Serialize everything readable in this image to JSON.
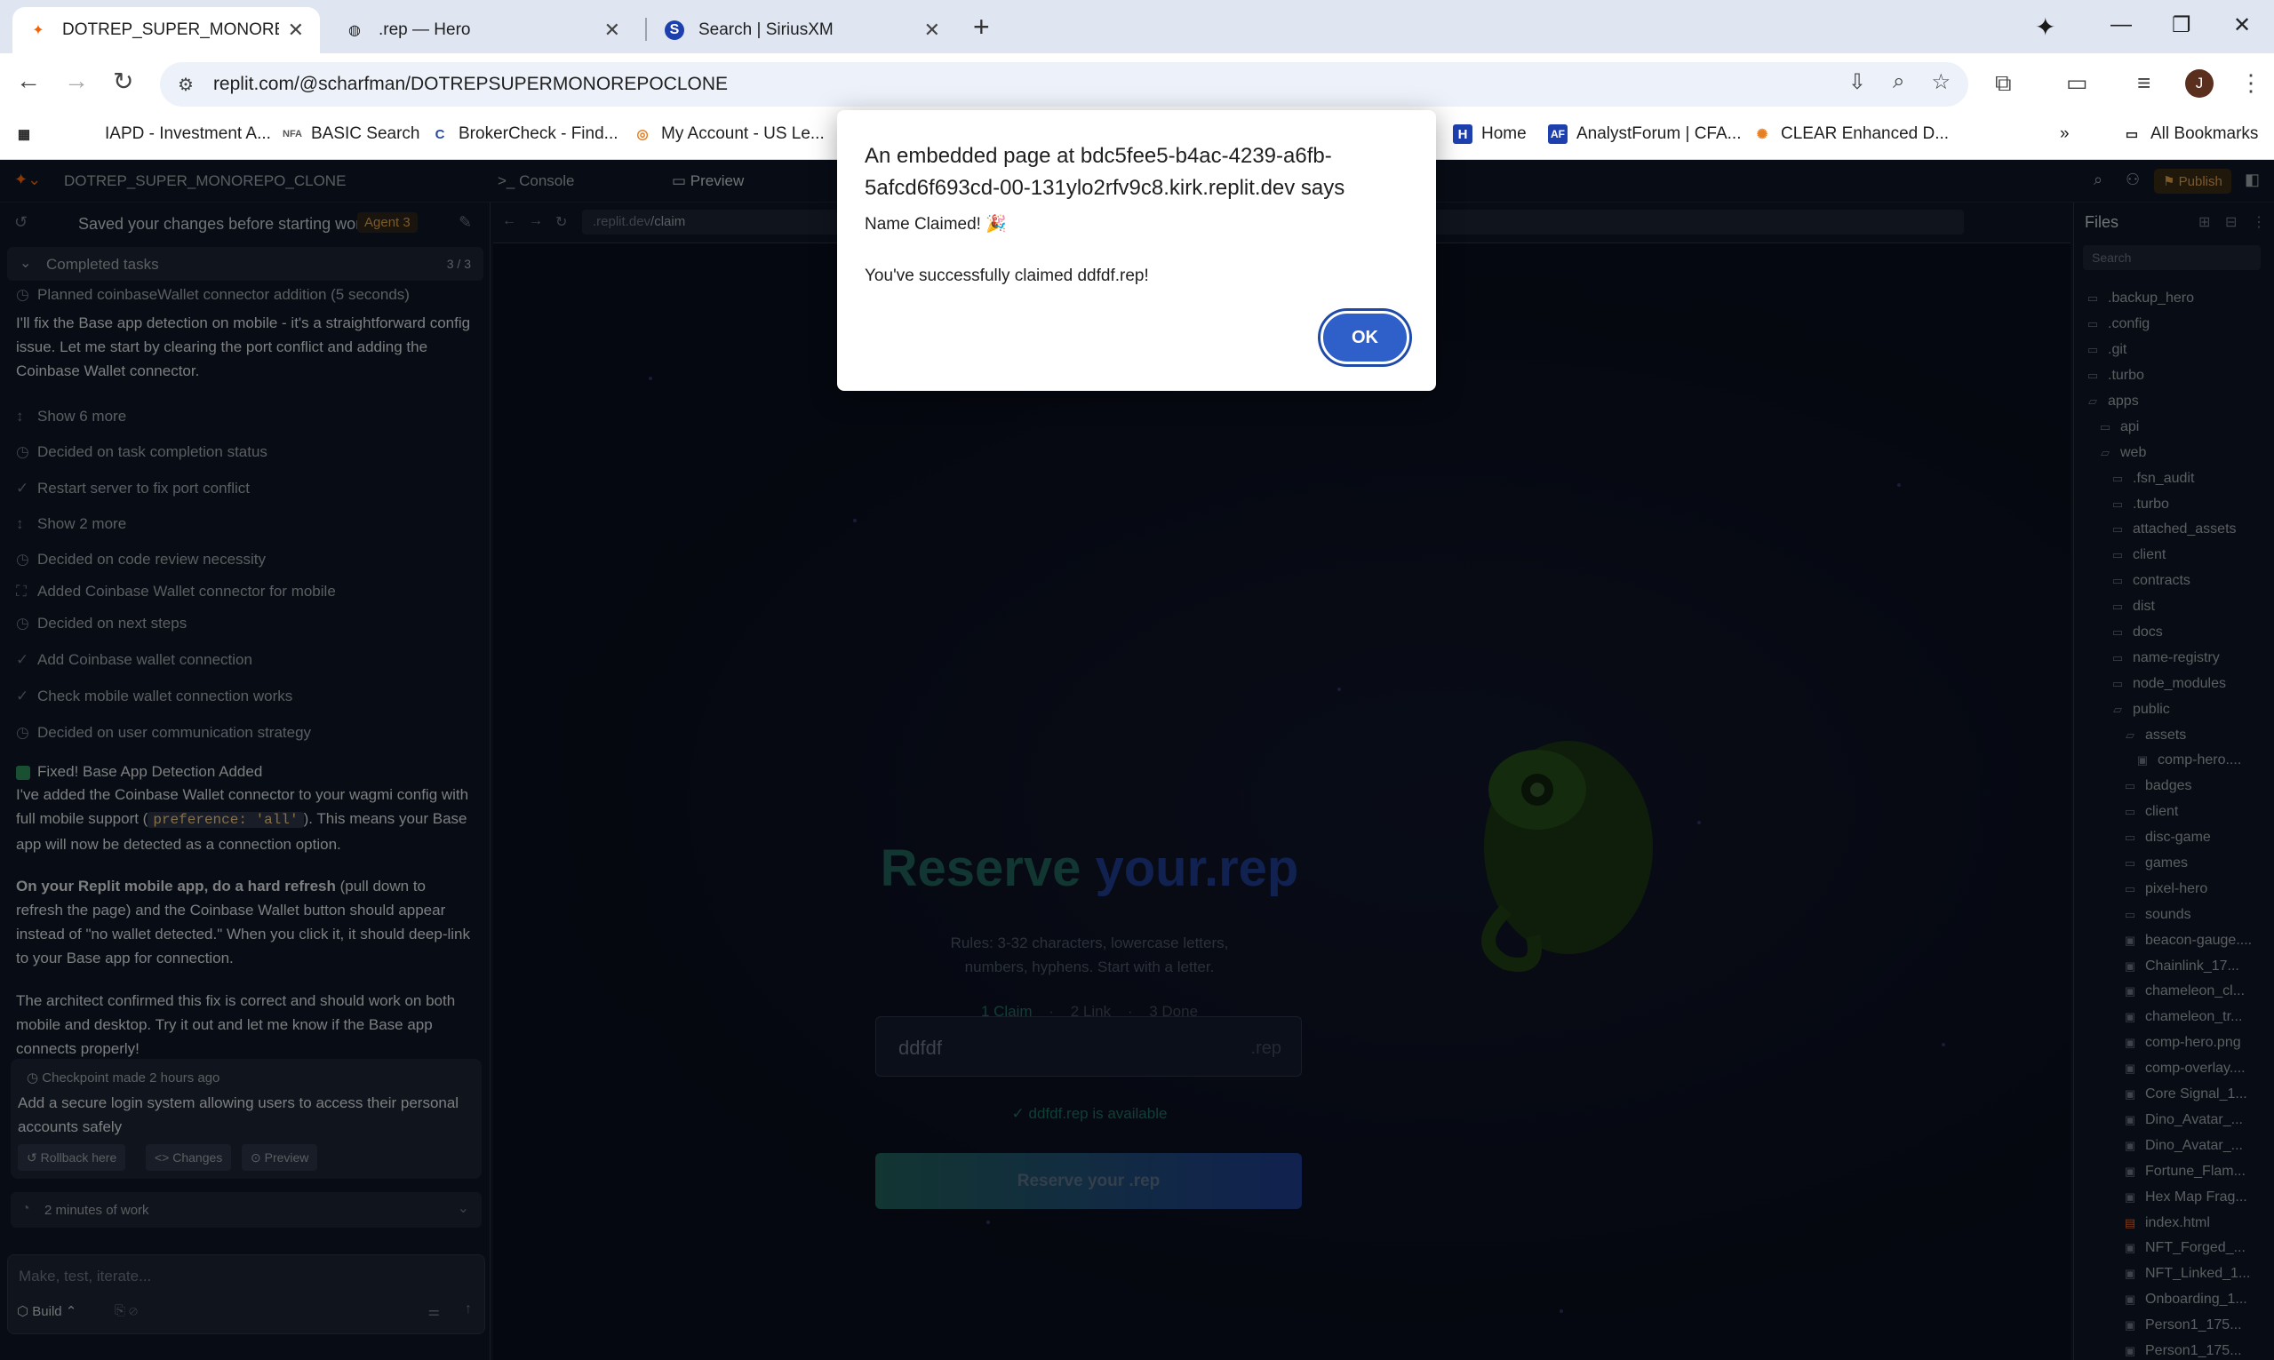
{
  "browser": {
    "tabs": [
      {
        "title": "DOTREP_SUPER_MONOREPO_C",
        "active": true
      },
      {
        "title": ".rep — Hero",
        "active": false
      },
      {
        "title": "Search | SiriusXM",
        "active": false
      }
    ],
    "url": "replit.com/@scharfman/DOTREPSUPERMONOREPOCLONE",
    "bookmarks": [
      "IAPD - Investment A...",
      "BASIC Search",
      "BrokerCheck - Find...",
      "My Account - US Le...",
      "Home",
      "AnalystForum | CFA...",
      "CLEAR Enhanced D..."
    ],
    "all_bookmarks": "All Bookmarks",
    "profile_initial": "J"
  },
  "replit": {
    "project_name": "DOTREP_SUPER_MONOREPO_CLONE",
    "console_tab": "Console",
    "preview_tab": "Preview",
    "publish": "Publish",
    "saved_msg": "Saved your changes before starting work",
    "agent_badge": "Agent 3",
    "completed_tasks": "Completed tasks",
    "completed_count": "3 / 3",
    "task_lines": [
      "Planned coinbaseWallet connector addition (5 seconds)",
      "Show 6 more",
      "Decided on task completion status",
      "Restart server to fix port conflict",
      "Show 2 more",
      "Decided on code review necessity",
      "Added Coinbase Wallet connector for mobile",
      "Decided on next steps",
      "Add Coinbase wallet connection",
      "Check mobile wallet connection works",
      "Decided on user communication strategy"
    ],
    "para_intro": "I'll fix the Base app detection on mobile - it's a straightforward config issue. Let me start by clearing the port conflict and adding the Coinbase Wallet connector.",
    "fixed_title": "Fixed! Base App Detection Added",
    "fixed_body_a": "I've added the Coinbase Wallet connector to your wagmi config with full mobile support (",
    "fixed_code": "preference: 'all'",
    "fixed_body_b": "). This means your Base app will now be detected as a connection option.",
    "mobile_bold": "On your Replit mobile app, do a hard refresh",
    "mobile_rest": " (pull down to refresh the page) and the Coinbase Wallet button should appear instead of \"no wallet detected.\" When you click it, it should deep-link to your Base app for connection.",
    "architect": "The architect confirmed this fix is correct and should work on both mobile and desktop. Try it out and let me know if the Base app connects properly!",
    "checkpoint_title": "Checkpoint made 2 hours ago",
    "checkpoint_desc": "Add a secure login system allowing users to access their personal accounts safely",
    "rollback": "Rollback here",
    "changes": "Changes",
    "preview_btn": "Preview",
    "work_time": "2 minutes of work",
    "prompt_placeholder": "Make, test, iterate...",
    "build": "Build"
  },
  "preview": {
    "url_host": ".replit.dev",
    "url_path": "/claim",
    "headline_a": "Reserve",
    "headline_b": "your.rep",
    "rules_line1": "Rules: 3-32 characters, lowercase letters,",
    "rules_line2": "numbers, hyphens. Start with a letter.",
    "step1": "1 Claim",
    "step2": "2 Link",
    "step3": "3 Done",
    "input_value": "ddfdf",
    "input_suffix": ".rep",
    "available": "ddfdf.rep is available",
    "reserve_btn": "Reserve your .rep"
  },
  "files": {
    "title": "Files",
    "search_placeholder": "Search",
    "items": [
      {
        "name": ".backup_hero",
        "type": "folder",
        "depth": 0
      },
      {
        "name": ".config",
        "type": "folder",
        "depth": 0
      },
      {
        "name": ".git",
        "type": "folder",
        "depth": 0
      },
      {
        "name": ".turbo",
        "type": "folder",
        "depth": 0
      },
      {
        "name": "apps",
        "type": "folder-open",
        "depth": 0
      },
      {
        "name": "api",
        "type": "folder",
        "depth": 1
      },
      {
        "name": "web",
        "type": "folder-open",
        "depth": 1
      },
      {
        "name": ".fsn_audit",
        "type": "folder",
        "depth": 2
      },
      {
        "name": ".turbo",
        "type": "folder",
        "depth": 2
      },
      {
        "name": "attached_assets",
        "type": "folder",
        "depth": 2
      },
      {
        "name": "client",
        "type": "folder",
        "depth": 2
      },
      {
        "name": "contracts",
        "type": "folder",
        "depth": 2
      },
      {
        "name": "dist",
        "type": "folder",
        "depth": 2
      },
      {
        "name": "docs",
        "type": "folder",
        "depth": 2
      },
      {
        "name": "name-registry",
        "type": "folder",
        "depth": 2
      },
      {
        "name": "node_modules",
        "type": "folder",
        "depth": 2
      },
      {
        "name": "public",
        "type": "folder-open",
        "depth": 2
      },
      {
        "name": "assets",
        "type": "folder-open",
        "depth": 3
      },
      {
        "name": "comp-hero....",
        "type": "image",
        "depth": 4
      },
      {
        "name": "badges",
        "type": "folder",
        "depth": 3
      },
      {
        "name": "client",
        "type": "folder",
        "depth": 3
      },
      {
        "name": "disc-game",
        "type": "folder",
        "depth": 3
      },
      {
        "name": "games",
        "type": "folder",
        "depth": 3
      },
      {
        "name": "pixel-hero",
        "type": "folder",
        "depth": 3
      },
      {
        "name": "sounds",
        "type": "folder",
        "depth": 3
      },
      {
        "name": "beacon-gauge....",
        "type": "image",
        "depth": 3
      },
      {
        "name": "Chainlink_17...",
        "type": "image",
        "depth": 3
      },
      {
        "name": "chameleon_cl...",
        "type": "image",
        "depth": 3
      },
      {
        "name": "chameleon_tr...",
        "type": "image",
        "depth": 3
      },
      {
        "name": "comp-hero.png",
        "type": "image",
        "depth": 3
      },
      {
        "name": "comp-overlay....",
        "type": "image",
        "depth": 3
      },
      {
        "name": "Core Signal_1...",
        "type": "image",
        "depth": 3
      },
      {
        "name": "Dino_Avatar_...",
        "type": "image",
        "depth": 3
      },
      {
        "name": "Dino_Avatar_...",
        "type": "image",
        "depth": 3
      },
      {
        "name": "Fortune_Flam...",
        "type": "image",
        "depth": 3
      },
      {
        "name": "Hex Map Frag...",
        "type": "image",
        "depth": 3
      },
      {
        "name": "index.html",
        "type": "html",
        "depth": 3
      },
      {
        "name": "NFT_Forged_...",
        "type": "image",
        "depth": 3
      },
      {
        "name": "NFT_Linked_1...",
        "type": "image",
        "depth": 3
      },
      {
        "name": "Onboarding_1...",
        "type": "image",
        "depth": 3
      },
      {
        "name": "Person1_175...",
        "type": "image",
        "depth": 3
      },
      {
        "name": "Person1_175...",
        "type": "image",
        "depth": 3
      }
    ]
  },
  "dialog": {
    "title": "An embedded page at bdc5fee5-b4ac-4239-a6fb-5afcd6f693cd-00-131ylo2rfv9c8.kirk.replit.dev says",
    "line1": "Name Claimed! 🎉",
    "line2": "You've successfully claimed ddfdf.rep!",
    "ok": "OK"
  }
}
